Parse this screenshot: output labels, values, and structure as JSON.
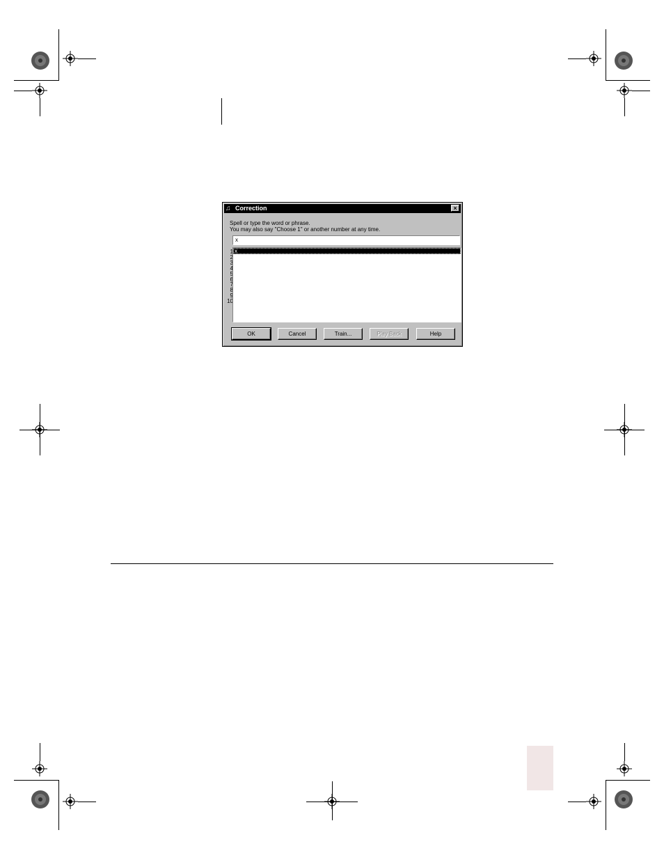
{
  "dialog": {
    "title": "Correction",
    "prompt_line1": "Spell or type the word or phrase.",
    "prompt_line2": "You may also say \"Choose 1\" or another number at any time.",
    "entry_value": "x",
    "numbers": [
      "1",
      "2",
      "3",
      "4",
      "5",
      "6",
      "7",
      "8",
      "9",
      "10"
    ],
    "list_items": [
      "x"
    ],
    "buttons": {
      "ok": "OK",
      "cancel": "Cancel",
      "train": "Train...",
      "play_back": "Play Back",
      "help": "Help"
    },
    "close_glyph": "×"
  },
  "icons": {
    "title_icon": "dictation-app-icon",
    "close_icon": "close-icon",
    "registration_mark": "crosshair-icon",
    "color_rosette": "rosette-icon"
  }
}
